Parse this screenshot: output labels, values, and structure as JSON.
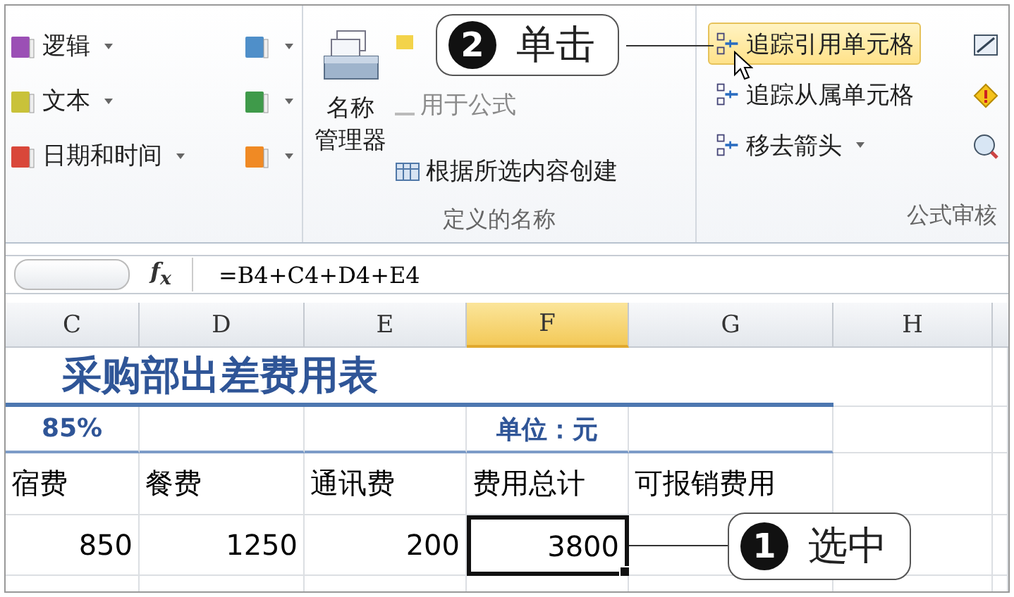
{
  "ribbon": {
    "function_library": {
      "buttons": [
        {
          "label": "逻辑"
        },
        {
          "label": "文本"
        },
        {
          "label": "日期和时间"
        }
      ]
    },
    "defined_names": {
      "name_manager_lines": [
        "名称",
        "管理器"
      ],
      "use_in_formula": "用于公式",
      "create_from_selection": "根据所选内容创建",
      "group_label": "定义的名称"
    },
    "formula_auditing": {
      "items": [
        {
          "label": "追踪引用单元格",
          "highlighted": true,
          "dropdown": false
        },
        {
          "label": "追踪从属单元格",
          "highlighted": false,
          "dropdown": false
        },
        {
          "label": "移去箭头",
          "highlighted": false,
          "dropdown": true
        }
      ],
      "group_label": "公式审核"
    }
  },
  "formula_bar": {
    "function_symbol": "f$_{x}$",
    "formula": "=B4+C4+D4+E4"
  },
  "sheet": {
    "columns": [
      {
        "label": "C",
        "selected": false
      },
      {
        "label": "D",
        "selected": false
      },
      {
        "label": "E",
        "selected": false
      },
      {
        "label": "F",
        "selected": true
      },
      {
        "label": "G",
        "selected": false
      },
      {
        "label": "H",
        "selected": false
      }
    ],
    "title": "采购部出差费用表",
    "info_row": {
      "rate": "85%",
      "unit": "单位：元"
    },
    "header_row": [
      "宿费",
      "餐费",
      "通讯费",
      "费用总计",
      "可报销费用"
    ],
    "data_row": [
      {
        "value": "850",
        "selected": false
      },
      {
        "value": "1250",
        "selected": false
      },
      {
        "value": "200",
        "selected": false
      },
      {
        "value": "3800",
        "selected": true
      }
    ]
  },
  "callouts": [
    {
      "number": "2",
      "text": "单击"
    },
    {
      "number": "1",
      "text": "选中"
    }
  ]
}
